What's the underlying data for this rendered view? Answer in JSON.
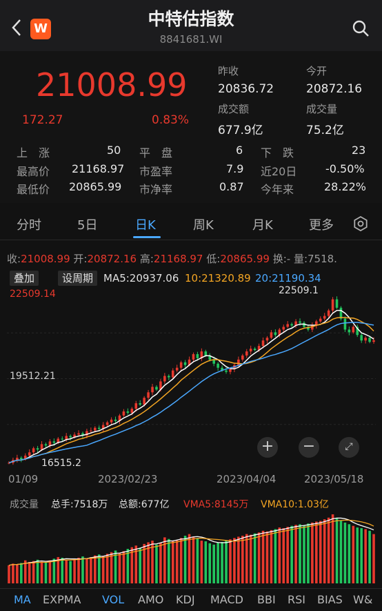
{
  "header": {
    "title": "中特估指数",
    "code": "8841681.WI",
    "logo_letter": "W"
  },
  "quote": {
    "price": "21008.99",
    "change": "172.27",
    "change_pct": "0.83%",
    "prev_close_label": "昨收",
    "prev_close": "20836.72",
    "open_label": "今开",
    "open": "20872.16",
    "turnover_label": "成交额",
    "turnover": "677.9亿",
    "volume_label": "成交量",
    "volume": "75.2亿",
    "rows": [
      {
        "k1": "上　涨",
        "v1": "50",
        "k2": "平　盘",
        "v2": "6",
        "k3": "下　跌",
        "v3": "23"
      },
      {
        "k1": "最高价",
        "v1": "21168.97",
        "k2": "市盈率",
        "v2": "7.9",
        "k3": "近20日",
        "v3": "-0.50%"
      },
      {
        "k1": "最低价",
        "v1": "20865.99",
        "k2": "市净率",
        "v2": "0.87",
        "k3": "今年来",
        "v3": "28.22%"
      }
    ]
  },
  "tabs": [
    "分时",
    "5日",
    "日K",
    "周K",
    "月K",
    "更多"
  ],
  "active_tab": "日K",
  "kinfo": {
    "close_label": "收:",
    "close": "21008.99",
    "open_label": "开:",
    "open": "20872.16",
    "high_label": "高:",
    "high": "21168.97",
    "low_label": "低:",
    "low": "20865.99",
    "turn_label": "换:-",
    "vol_label": "量:7518."
  },
  "mabar": {
    "overlay": "叠加",
    "set_period": "设周期",
    "ma5": "MA5:20937.06",
    "ma10": "10:21320.89",
    "ma20": "20:21190.34"
  },
  "chart_labels": {
    "top": "22509.14",
    "mid": "19512.21",
    "max_note": "22509.1",
    "min_note": "16515.2"
  },
  "dates": [
    "01/09",
    "2023/02/23",
    "2023/04/04",
    "2023/05/18"
  ],
  "volbar": {
    "label": "成交量",
    "total_hands": "总手:7518万",
    "total_amount": "总额:677亿",
    "vma5": "VMA5:8145万",
    "vma10": "VMA10:1.03亿"
  },
  "indicators": [
    "MA",
    "EXPMA",
    "VOL",
    "AMO",
    "KDJ",
    "MACD",
    "BBI",
    "RSI",
    "BIAS",
    "W&"
  ],
  "colors": {
    "up": "#e8392d",
    "down": "#22c55e",
    "ma5": "#ffffff",
    "ma10": "#f5a623",
    "ma20": "#4aa8ff",
    "accent": "#4aa8ff"
  },
  "chart_data": {
    "type": "candlestick",
    "ylim": [
      16500,
      22700
    ],
    "close": [
      16515,
      16620,
      16700,
      16650,
      16780,
      16900,
      17050,
      17000,
      17200,
      17150,
      17300,
      17250,
      17400,
      17380,
      17500,
      17450,
      17550,
      17600,
      17520,
      17680,
      17700,
      17800,
      17760,
      17900,
      18000,
      18100,
      18050,
      18250,
      18400,
      18350,
      18500,
      18700,
      18650,
      18900,
      19100,
      19300,
      19200,
      19500,
      19700,
      19650,
      19900,
      20000,
      20200,
      20100,
      20300,
      20500,
      20350,
      20600,
      20450,
      20300,
      20150,
      20000,
      19900,
      19850,
      19950,
      20100,
      20300,
      20450,
      20600,
      20700,
      20650,
      20800,
      21000,
      21100,
      21300,
      21200,
      21400,
      21500,
      21600,
      21550,
      21700,
      21650,
      21500,
      21400,
      21550,
      21700,
      21800,
      21900,
      22100,
      22509,
      22200,
      21800,
      21400,
      21300,
      21500,
      21200,
      21000,
      21100,
      20950,
      21009
    ],
    "volume": [
      55,
      60,
      58,
      62,
      70,
      65,
      68,
      72,
      66,
      64,
      70,
      75,
      80,
      78,
      72,
      68,
      74,
      78,
      82,
      76,
      80,
      85,
      88,
      84,
      90,
      95,
      100,
      92,
      98,
      105,
      110,
      115,
      108,
      120,
      125,
      130,
      118,
      124,
      140,
      135,
      128,
      132,
      138,
      145,
      150,
      142,
      136,
      130,
      128,
      122,
      118,
      124,
      126,
      130,
      134,
      138,
      142,
      145,
      150,
      148,
      152,
      155,
      160,
      158,
      162,
      165,
      170,
      168,
      172,
      175,
      178,
      180,
      176,
      182,
      185,
      188,
      190,
      195,
      200,
      210,
      198,
      190,
      185,
      180,
      175,
      170,
      168,
      165,
      160,
      150
    ]
  }
}
